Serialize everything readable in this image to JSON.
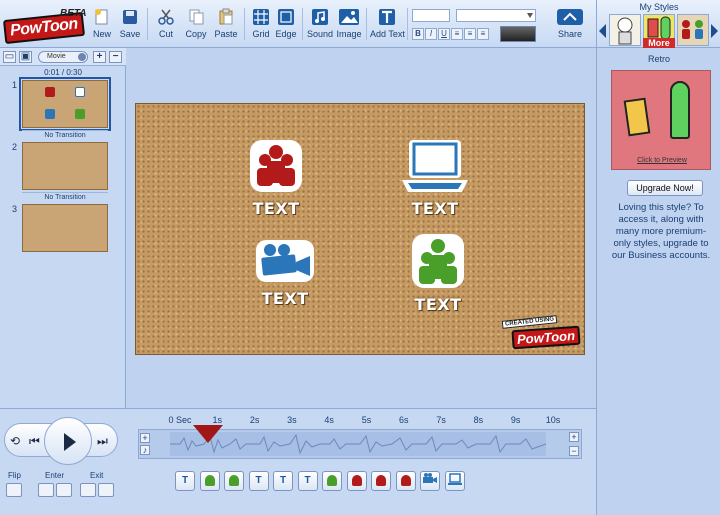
{
  "app": {
    "logo": "PowToon",
    "beta": "BETA"
  },
  "toolbar": {
    "new": "New",
    "save": "Save",
    "cut": "Cut",
    "copy": "Copy",
    "paste": "Paste",
    "grid": "Grid",
    "edge": "Edge",
    "sound": "Sound",
    "image": "Image",
    "add_text": "Add Text",
    "share": "Share",
    "bold": "B",
    "italic": "I",
    "underline": "U"
  },
  "slides_panel": {
    "movie_label": "Movie",
    "time_readout": "0:01 / 0:30",
    "slides": [
      {
        "number": "1",
        "transition": "No Transition"
      },
      {
        "number": "2",
        "transition": "No Transition"
      },
      {
        "number": "3"
      }
    ]
  },
  "stage": {
    "objects": [
      {
        "label": "TEXT",
        "icon": "people-red-icon"
      },
      {
        "label": "TEXT",
        "icon": "laptop-icon"
      },
      {
        "label": "TEXT",
        "icon": "camera-icon"
      },
      {
        "label": "TEXT",
        "icon": "people-green-icon"
      }
    ],
    "badge_made": "CREATED USING",
    "badge_brand": "PowToon"
  },
  "styles_panel": {
    "title": "My Styles",
    "more": "More",
    "style_name": "Retro",
    "preview_caption": "Click to Preview",
    "upgrade": "Upgrade Now!",
    "promo": "Loving this style? To access it, along with many more premium-only styles, upgrade to our Business accounts."
  },
  "timeline": {
    "ticks": [
      "0 Sec",
      "1s",
      "2s",
      "3s",
      "4s",
      "5s",
      "6s",
      "7s",
      "8s",
      "9s",
      "10s"
    ],
    "flip": "Flip",
    "enter": "Enter",
    "exit": "Exit",
    "chips": [
      "text-T",
      "person-green",
      "person-green",
      "text-T",
      "text-T",
      "text-T",
      "person-green",
      "person-red",
      "person-red",
      "person-red",
      "camera",
      "laptop"
    ]
  },
  "colors": {
    "accent": "#1f5fa8",
    "stage": "#c59a63",
    "red": "#b31b1b",
    "green": "#4a9e2a",
    "blue": "#2a76b9"
  }
}
